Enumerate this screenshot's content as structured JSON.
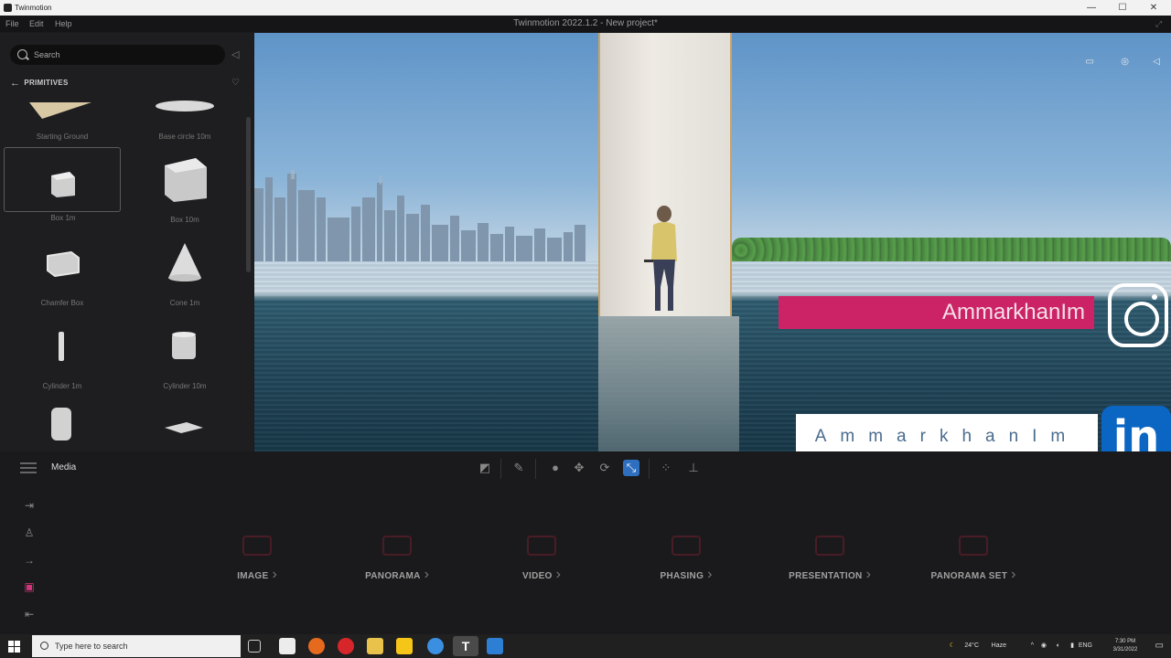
{
  "window": {
    "app_name": "Twinmotion",
    "title": "Twinmotion 2022.1.2 - New project*",
    "minimize": "—",
    "maximize": "☐",
    "close": "✕"
  },
  "menu": {
    "file": "File",
    "edit": "Edit",
    "help": "Help"
  },
  "library": {
    "search_placeholder": "Search",
    "breadcrumb": "PRIMITIVES",
    "items": [
      {
        "label": "Starting Ground"
      },
      {
        "label": "Base circle 10m"
      },
      {
        "label": "Box 1m"
      },
      {
        "label": "Box 10m"
      },
      {
        "label": "Chamfer Box"
      },
      {
        "label": "Cone 1m"
      },
      {
        "label": "Cylinder 1m"
      },
      {
        "label": "Cylinder 10m"
      },
      {
        "label": ""
      },
      {
        "label": ""
      }
    ]
  },
  "overlay": {
    "instagram_handle": "AmmarkhanIm",
    "linkedin_handle": "AmmarkhanIm",
    "linkedin_logo": "in",
    "colors": {
      "instagram_bar": "#cc2366",
      "linkedin_bg": "#0a66c2"
    }
  },
  "toolbar": {
    "panel_title": "Media"
  },
  "media": {
    "items": [
      {
        "label": "IMAGE",
        "icon": "camera-icon"
      },
      {
        "label": "PANORAMA",
        "icon": "panorama-icon"
      },
      {
        "label": "VIDEO",
        "icon": "video-icon"
      },
      {
        "label": "PHASING",
        "icon": "phasing-icon"
      },
      {
        "label": "PRESENTATION",
        "icon": "presentation-icon"
      },
      {
        "label": "PANORAMA SET",
        "icon": "panorama-set-icon"
      }
    ],
    "chevron": "›"
  },
  "taskbar": {
    "search_placeholder": "Type here to search",
    "weather": "24°C",
    "weather_desc": "Haze",
    "language": "ENG",
    "time": "7:30 PM",
    "date": "3/31/2022"
  }
}
